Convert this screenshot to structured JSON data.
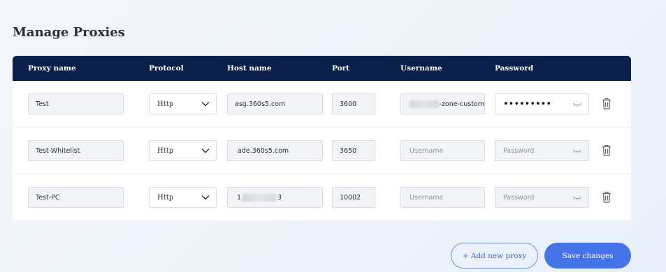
{
  "title": "Manage Proxies",
  "columns": [
    "Proxy name",
    "Protocol",
    "Host name",
    "Port",
    "Username",
    "Password"
  ],
  "rows": [
    {
      "name": "Test",
      "protocol": "Http",
      "host": "asg.360s5.com",
      "port": "3600",
      "username": "-zone-custom",
      "username_redacted": true,
      "password": "•••••••••",
      "password_filled": true
    },
    {
      "name": "Test-Whitelist",
      "protocol": "Http",
      "host": "ade.360s5.com",
      "port": "3650",
      "username": "Username",
      "username_placeholder": true,
      "password": "Password",
      "password_filled": false
    },
    {
      "name": "Test-PC",
      "protocol": "Http",
      "host_prefix": "1",
      "host_suffix": "3",
      "host_redacted": true,
      "port": "10002",
      "username": "Username",
      "username_placeholder": true,
      "password": "Password",
      "password_filled": false
    }
  ],
  "actions": {
    "add": "+ Add new proxy",
    "save": "Save changes"
  },
  "icons": {
    "protocol_dropdown": "chevron-down-icon",
    "password_toggle": "eye-closed-icon",
    "delete": "trash-icon"
  },
  "colors": {
    "header_bg": "#0b1f4b",
    "primary": "#4573e8",
    "primary_outline": "#6b8be6"
  }
}
